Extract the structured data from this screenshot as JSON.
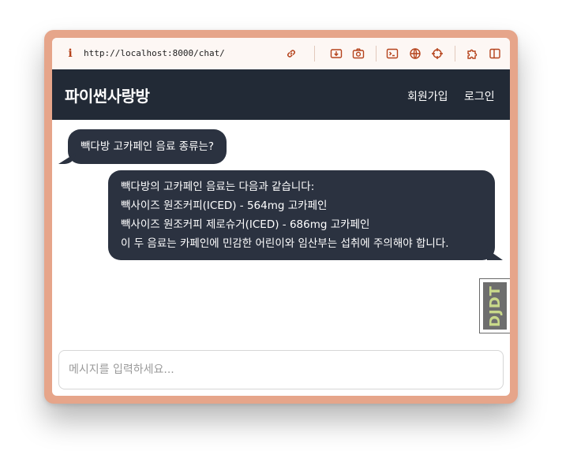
{
  "browser": {
    "url": "http://localhost:8000/chat/",
    "tools": [
      "link-icon",
      "download-icon",
      "camera-icon",
      "terminal-icon",
      "globe-icon",
      "crosshair-icon",
      "puzzle-icon",
      "sidebar-icon"
    ]
  },
  "header": {
    "brand": "파이썬사랑방",
    "signup_label": "회원가입",
    "login_label": "로그인"
  },
  "messages": {
    "user": "빽다방 고카페인 음료 종류는?",
    "bot": [
      "빽다방의 고카페인 음료는 다음과 같습니다:",
      "빽사이즈 원조커피(ICED) - 564mg 고카페인",
      "빽사이즈 원조커피 제로슈거(ICED) - 686mg 고카페인",
      "이 두 음료는 카페인에 민감한 어린이와 임산부는 섭취에 주의해야 합니다."
    ]
  },
  "badge": {
    "text": "DJDT"
  },
  "composer": {
    "placeholder": "메시지를 입력하세요..."
  },
  "colors": {
    "header_bg": "#222a36",
    "bubble_bg": "#2b3240",
    "frame": "#e6a58a",
    "accent": "#b5431c"
  }
}
